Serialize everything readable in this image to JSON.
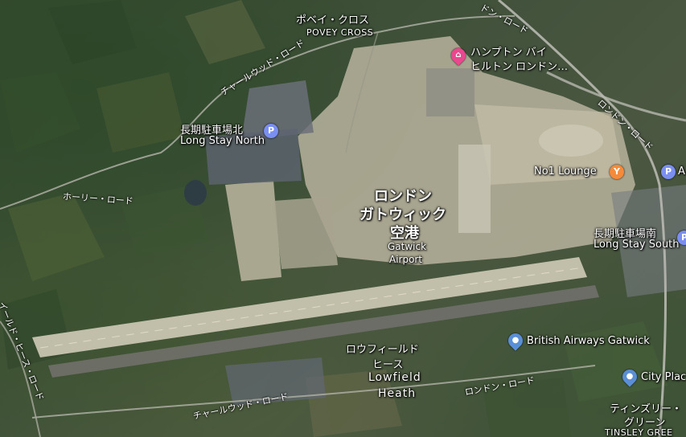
{
  "map": {
    "type": "satellite",
    "colors": {
      "parking": "#7b8ff0",
      "hotel": "#e9488f",
      "lounge": "#f58a3a",
      "place": "#5a8fd6"
    }
  },
  "airport": {
    "name_jp_line1": "ロンドン",
    "name_jp_line2": "ガトウィック",
    "name_jp_line3": "空港",
    "name_en_line1": "Gatwick",
    "name_en_line2": "Airport"
  },
  "places": {
    "povey_cross_jp": "ポベイ・クロス",
    "povey_cross_en": "POVEY CROSS",
    "lowfield_jp_line1": "ロウフィールド",
    "lowfield_jp_line2": "ヒース",
    "lowfield_en_line1": "Lowfield",
    "lowfield_en_line2": "Heath",
    "tinsley_jp_line1": "ティンズリー・",
    "tinsley_jp_line2": "グリーン",
    "tinsley_en": "TINSLEY GREE"
  },
  "pois": {
    "hotel_line1": "ハンプトン バイ",
    "hotel_line2": "ヒルトン ロンドン…",
    "long_stay_north_jp": "長期駐車場北",
    "long_stay_north_en": "Long Stay North",
    "lounge": "No1 Lounge",
    "long_stay_south_jp": "長期駐車場南",
    "long_stay_south_en": "Long Stay South",
    "british_airways": "British Airways Gatwick",
    "city_place": "City Plac",
    "edge_label": "A"
  },
  "roads": {
    "charlwood_north": "チャールウッド・ロード",
    "charlwood_south": "チャールウッド・ロード",
    "horley": "ホーリー・ロード",
    "london_road_ne": "ロンドン・ロード",
    "london_road_top": "ドン・ロード",
    "london_road_s": "ロンドン・ロード",
    "heath_road": "イールド・ヒース・ロード"
  },
  "icons": {
    "parking": "P",
    "lounge": "Y",
    "hotel": "bed-icon",
    "place": "pin-icon"
  }
}
